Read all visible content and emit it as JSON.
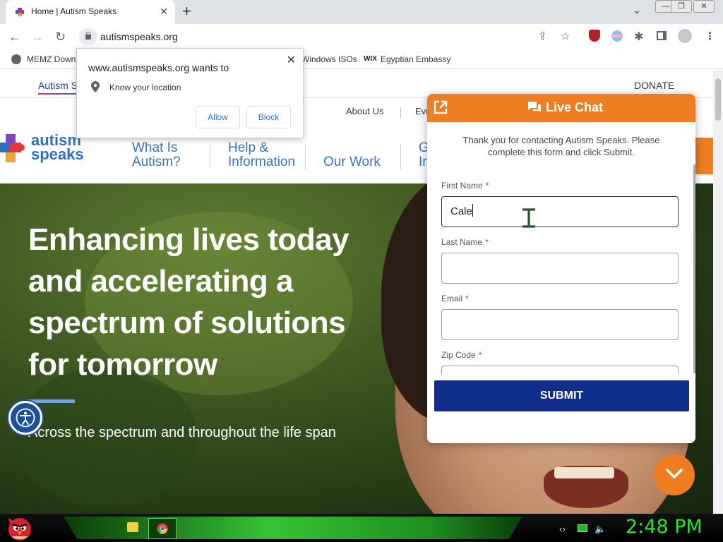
{
  "browser": {
    "tab_title": "Home | Autism Speaks",
    "url": "autismspeaks.org",
    "bookmarks": [
      "MEMZ Down",
      "Windows ISOs",
      "Egyptian Embassy"
    ]
  },
  "location_prompt": {
    "title": "www.autismspeaks.org wants to",
    "permission": "Know your location",
    "allow": "Allow",
    "block": "Block"
  },
  "site": {
    "topbar_brand": "Autism S",
    "donate": "DONATE",
    "util_nav": [
      "About Us",
      "Eve"
    ],
    "logo_line1": "autism",
    "logo_line2": "speaks",
    "nav": {
      "what_1": "What Is",
      "what_2": "Autism?",
      "help_1": "Help &",
      "help_2": "Information",
      "work": "Our Work",
      "g_1": "G",
      "g_2": "Ir"
    },
    "hero_title": "Enhancing lives today and accelerating a spectrum of solutions for tomorrow",
    "hero_sub": "Across the spectrum and throughout the life span"
  },
  "chat": {
    "title": "Live Chat",
    "intro": "Thank you for contacting Autism Speaks. Please complete this form and click Submit.",
    "fields": {
      "first_name_label": "First Name",
      "first_name_value": "Cale",
      "last_name_label": "Last Name",
      "email_label": "Email",
      "zip_label": "Zip Code",
      "required_mark": "*"
    },
    "submit": "SUBMIT"
  },
  "taskbar": {
    "clock": "2:48 PM"
  },
  "colors": {
    "chat_orange": "#ef7d22",
    "submit_navy": "#0f2e8c",
    "nav_blue": "#3473c2",
    "clock_green": "#28e628"
  }
}
